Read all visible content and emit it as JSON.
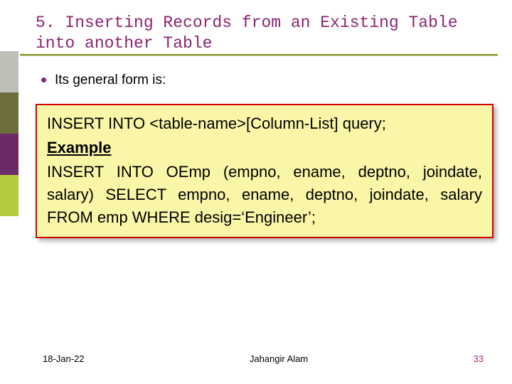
{
  "title": "5. Inserting Records from an Existing Table into another Table",
  "bullet": "Its general form is:",
  "codebox": {
    "syntax": "INSERT INTO <table-name>[Column-List] query;",
    "example_label": "Example",
    "example_body": "INSERT INTO OEmp (empno, ename, deptno, joindate, salary) SELECT empno, ename, deptno, joindate, salary FROM emp WHERE desig=‘Engineer’;"
  },
  "footer": {
    "date": "18-Jan-22",
    "author": "Jahangir Alam",
    "page": "33"
  }
}
